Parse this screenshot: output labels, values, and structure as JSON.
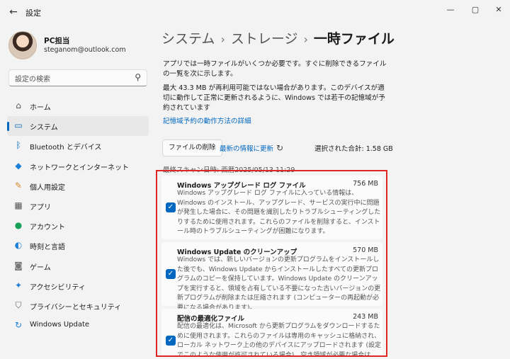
{
  "window": {
    "title": "設定",
    "back_icon": "←",
    "minimize_icon": "—",
    "maximize_icon": "▢",
    "close_icon": "✕"
  },
  "profile": {
    "name": "PC担当",
    "email": "steganom@outlook.com"
  },
  "search": {
    "placeholder": "設定の検索"
  },
  "sidebar": {
    "items": [
      {
        "label": "ホーム",
        "icon": "home-icon",
        "glyph": "⌂",
        "color": "#555",
        "active": false
      },
      {
        "label": "システム",
        "icon": "system-icon",
        "glyph": "▭",
        "color": "#0067c0",
        "active": true
      },
      {
        "label": "Bluetooth とデバイス",
        "icon": "bluetooth-icon",
        "glyph": "ᛒ",
        "color": "#0067c0",
        "active": false
      },
      {
        "label": "ネットワークとインターネット",
        "icon": "network-icon",
        "glyph": "◆",
        "color": "#1b7fd6",
        "active": false
      },
      {
        "label": "個人用設定",
        "icon": "brush-icon",
        "glyph": "✎",
        "color": "#d68a2d",
        "active": false
      },
      {
        "label": "アプリ",
        "icon": "apps-icon",
        "glyph": "▦",
        "color": "#555",
        "active": false
      },
      {
        "label": "アカウント",
        "icon": "account-icon",
        "glyph": "●",
        "color": "#1aa05a",
        "active": false
      },
      {
        "label": "時刻と言語",
        "icon": "time-language-icon",
        "glyph": "◐",
        "color": "#1b7fd6",
        "active": false
      },
      {
        "label": "ゲーム",
        "icon": "game-icon",
        "glyph": "◙",
        "color": "#777",
        "active": false
      },
      {
        "label": "アクセシビリティ",
        "icon": "accessibility-icon",
        "glyph": "✦",
        "color": "#1b7fd6",
        "active": false
      },
      {
        "label": "プライバシーとセキュリティ",
        "icon": "shield-icon",
        "glyph": "⛉",
        "color": "#666",
        "active": false
      },
      {
        "label": "Windows Update",
        "icon": "windows-update-icon",
        "glyph": "↻",
        "color": "#1b7fd6",
        "active": false
      }
    ]
  },
  "breadcrumb": {
    "items": [
      "システム",
      "ストレージ"
    ],
    "current": "一時ファイル",
    "separator": "›"
  },
  "main": {
    "intro": "アプリでは一時ファイルがいくつか必要です。すぐに削除できるファイルの一覧を次に示します。",
    "reserved_note": "最大 43.3 MB が再利用可能ではない場合があります。このデバイスが適切に動作して正常に更新されるように、Windows では若干の記憶域が予約されています",
    "reserved_link": "記憶域予約の動作方法の詳細",
    "remove_button": "ファイルの削除",
    "refresh_label": "最新の情報に更新",
    "refresh_icon": "↻",
    "total_selected": "選択された合計: 1.58 GB",
    "last_scan": "最終スキャン日時: 西暦2025/05/13 11:29",
    "files": [
      {
        "name": "Windows アップグレード ログ ファイル",
        "size": "756 MB",
        "checked": true,
        "description": "Windows アップグレード ログ ファイルに入っている情報は、Windows のインストール、アップグレード、サービスの実行中に問題が発生した場合に、その問題を識別したりトラブルシューティングしたりするために使用されます。これらのファイルを削除すると、インストール時のトラブルシューティングが困難になります。"
      },
      {
        "name": "Windows Update のクリーンアップ",
        "size": "570 MB",
        "checked": true,
        "description": "Windows では、新しいバージョンの更新プログラムをインストールした後でも、Windows Update からインストールしたすべての更新プログラムのコピーを保持しています。Windows Update のクリーンアップを実行すると、領域を占有している不要になった古いバージョンの更新プログラムが削除または圧縮されます (コンピューターの再起動が必要になる場合があります)。"
      },
      {
        "name": "配信の最適化ファイル",
        "size": "243 MB",
        "checked": true,
        "description": "配信の最適化は、Microsoft から更新プログラムをダウンロードするために使用されます。これらのファイルは専用のキャッシュに格納され、ローカル ネットワーク上の他のデバイスにアップロードされます (設定でこのような使用が許可されている場合)。空き領域が必要な場合は、これらのファイルを削除しても"
      }
    ],
    "check_glyph": "✓"
  }
}
